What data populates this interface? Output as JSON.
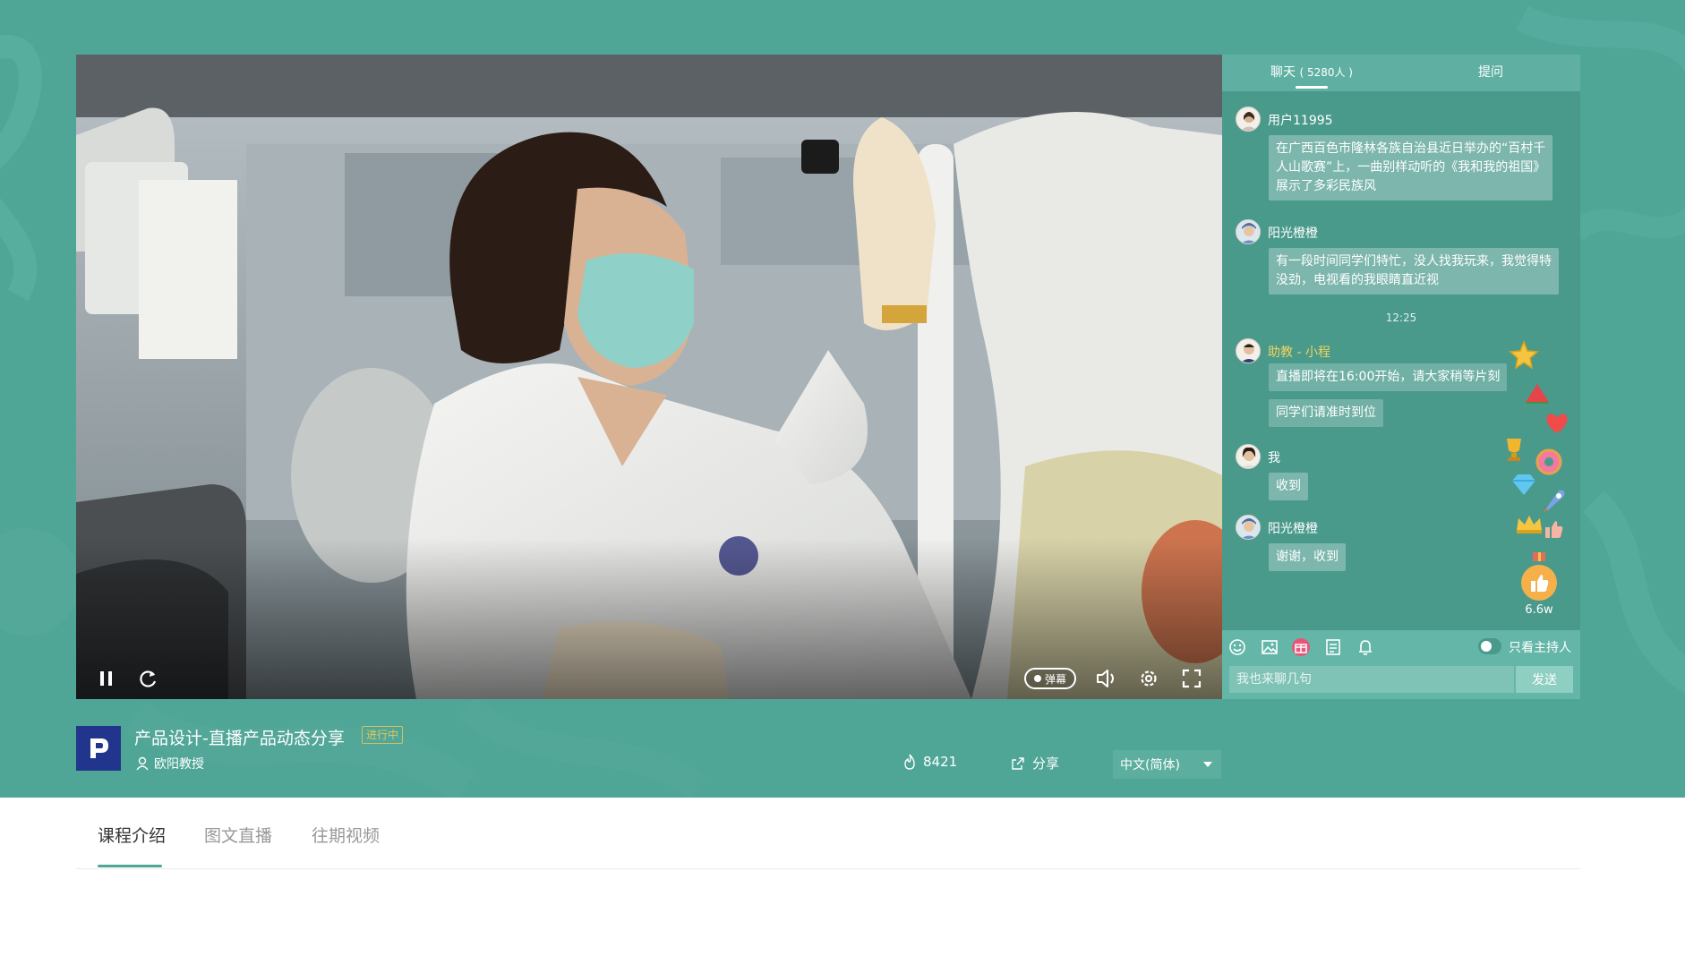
{
  "colors": {
    "brand": "#4fa596",
    "chat_panel": "#4a9a8c",
    "tutor_name": "#f3d35a",
    "logo_bg": "#22358c",
    "like_button": "#f5b04a"
  },
  "player": {
    "controls": [
      "pause-icon",
      "replay-icon",
      "volume-icon",
      "gear-icon",
      "fullscreen-icon"
    ],
    "danmu_label": "弹幕"
  },
  "chat": {
    "tabs": {
      "chat_label": "聊天",
      "chat_count": "( 5280人 )",
      "question_label": "提问"
    },
    "messages": [
      {
        "name": "用户11995",
        "lines": [
          "在广西百色市隆林各族自治县近日举办的“百村千",
          "人山歌赛”上，一曲别样动听的《我和我的祖国》",
          "展示了多彩民族风"
        ]
      },
      {
        "name": "阳光橙橙",
        "lines": [
          "有一段时间同学们特忙，没人找我玩来，我觉得特",
          "没劲，电视看的我眼睛直近视"
        ]
      }
    ],
    "time": "12:25",
    "tutor": {
      "name": "助教 - 小程",
      "messages": [
        "直播即将在16:00开始，请大家稍等片刻",
        "同学们请准时到位"
      ]
    },
    "me": {
      "name": "我",
      "message": "收到"
    },
    "last": {
      "name": "阳光橙橙",
      "message": "谢谢，收到"
    },
    "like_count": "6.6w",
    "host_only_label": "只看主持人",
    "input_placeholder": "我也来聊几句",
    "send_label": "发送",
    "tools": [
      "smile-icon",
      "image-icon",
      "gift-icon",
      "note-icon",
      "bell-icon"
    ]
  },
  "course": {
    "logo_letter": "P",
    "title": "产品设计-直播产品动态分享",
    "status_badge": "进行中",
    "teacher": "欧阳教授",
    "view_count": "8421",
    "share_label": "分享",
    "language": "中文(简体)"
  },
  "tabs": [
    "课程介绍",
    "图文直播",
    "往期视频"
  ]
}
